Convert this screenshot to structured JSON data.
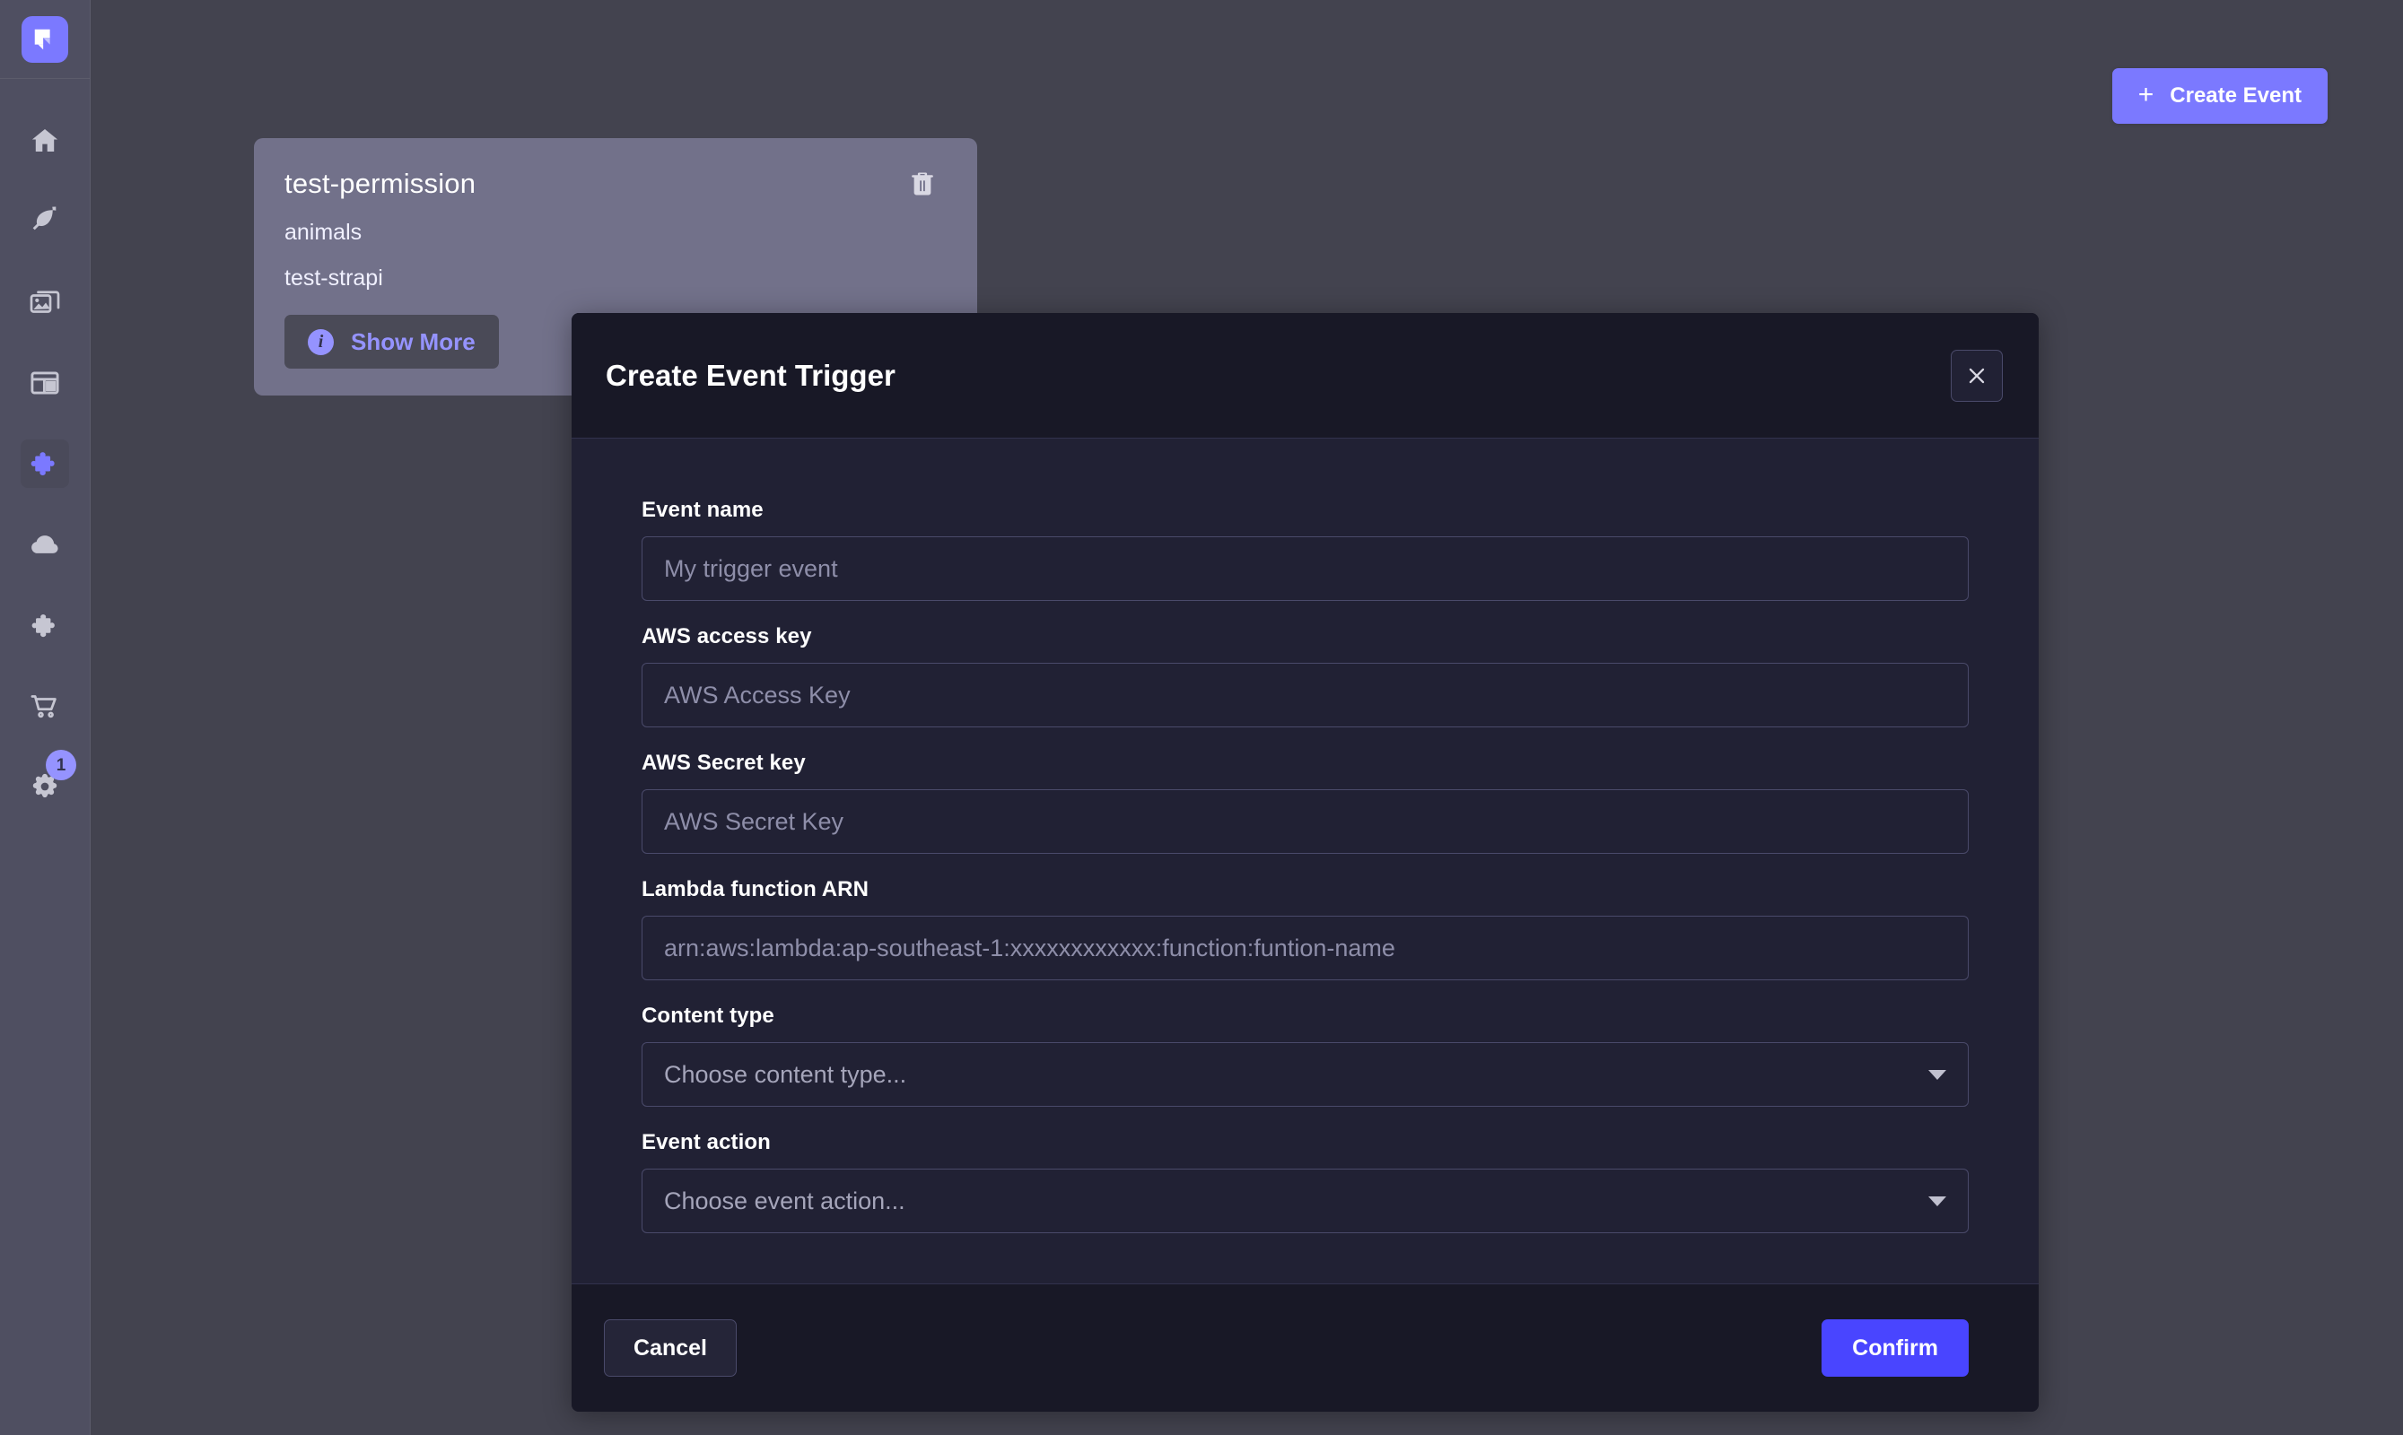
{
  "app": {
    "logo_name": "strapi-logo",
    "accent_color": "#7b79ff",
    "confirm_color": "#4945ff",
    "sidebar_bg": "#4f4f61",
    "canvas_bg": "#43434f",
    "modal_bg": "#212134",
    "modal_header_bg": "#181826",
    "card_bg": "#72718a"
  },
  "sidebar": {
    "items": [
      {
        "icon": "home-icon",
        "name": "sidebar-item-home",
        "active": false
      },
      {
        "icon": "feather-icon",
        "name": "sidebar-item-content",
        "active": false
      },
      {
        "icon": "images-icon",
        "name": "sidebar-item-media",
        "active": false
      },
      {
        "icon": "layout-icon",
        "name": "sidebar-item-content-type",
        "active": false
      },
      {
        "icon": "puzzle-icon",
        "name": "sidebar-item-plugins",
        "active": true
      },
      {
        "icon": "cloud-icon",
        "name": "sidebar-item-cloud",
        "active": false
      },
      {
        "icon": "puzzle-alt-icon",
        "name": "sidebar-item-marketplace",
        "active": false
      },
      {
        "icon": "cart-icon",
        "name": "sidebar-item-shop",
        "active": false
      },
      {
        "icon": "gear-icon",
        "name": "sidebar-item-settings",
        "active": false,
        "badge": "1"
      }
    ]
  },
  "topbar": {
    "create_event_label": "Create Event",
    "plus_glyph": "+"
  },
  "cards": [
    {
      "title": "test-permission",
      "line2": "animals",
      "line3": "test-strapi",
      "show_more_label": "Show More",
      "info_glyph": "i",
      "delete_icon": "trash-icon"
    }
  ],
  "modal": {
    "title": "Create Event Trigger",
    "close_icon": "close-icon",
    "fields": [
      {
        "label": "Event name",
        "placeholder": "My trigger event",
        "type": "text"
      },
      {
        "label": "AWS access key",
        "placeholder": "AWS Access Key",
        "type": "text"
      },
      {
        "label": "AWS Secret key",
        "placeholder": "AWS Secret Key",
        "type": "text"
      },
      {
        "label": "Lambda function ARN",
        "placeholder": "arn:aws:lambda:ap-southeast-1:xxxxxxxxxxxx:function:funtion-name",
        "type": "text"
      }
    ],
    "selects": [
      {
        "label": "Content type",
        "placeholder": "Choose content type...",
        "value": ""
      },
      {
        "label": "Event action",
        "placeholder": "Choose event action...",
        "value": ""
      }
    ],
    "footer": {
      "cancel_label": "Cancel",
      "confirm_label": "Confirm"
    }
  }
}
